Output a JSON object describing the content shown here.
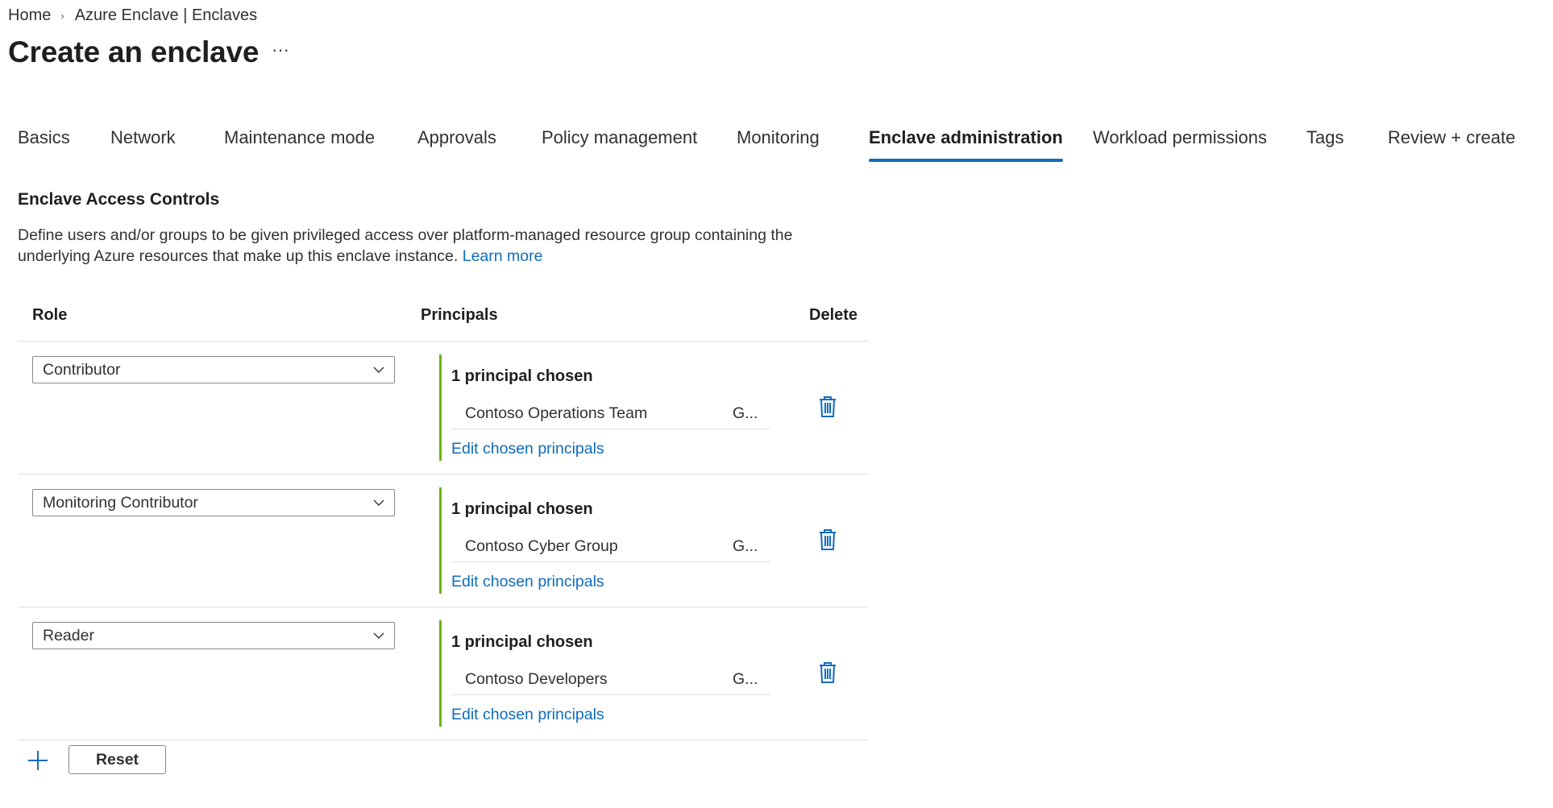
{
  "breadcrumb": {
    "home": "Home",
    "separator": "›",
    "current": "Azure Enclave | Enclaves"
  },
  "page": {
    "title": "Create an enclave",
    "more_label": "···"
  },
  "tabs": [
    {
      "label": "Basics"
    },
    {
      "label": "Network"
    },
    {
      "label": "Maintenance mode"
    },
    {
      "label": "Approvals"
    },
    {
      "label": "Policy management"
    },
    {
      "label": "Monitoring"
    },
    {
      "label": "Enclave administration",
      "active": true
    },
    {
      "label": "Workload permissions"
    },
    {
      "label": "Tags"
    },
    {
      "label": "Review + create"
    }
  ],
  "section": {
    "title": "Enclave Access Controls",
    "description": "Define users and/or groups to be given privileged access over platform-managed resource group containing the underlying Azure resources that make up this enclave instance.",
    "learn_more": "Learn more"
  },
  "table": {
    "headers": {
      "role": "Role",
      "principals": "Principals",
      "delete": "Delete"
    },
    "rows": [
      {
        "role": "Contributor",
        "panel_title": "1 principal chosen",
        "principal": "Contoso Operations Team",
        "principal_type": "G...",
        "edit_label": "Edit chosen principals"
      },
      {
        "role": "Monitoring Contributor",
        "panel_title": "1 principal chosen",
        "principal": "Contoso Cyber Group",
        "principal_type": "G...",
        "edit_label": "Edit chosen principals"
      },
      {
        "role": "Reader",
        "panel_title": "1 principal chosen",
        "principal": "Contoso Developers",
        "principal_type": "G...",
        "edit_label": "Edit chosen principals"
      }
    ]
  },
  "actions": {
    "reset_label": "Reset",
    "add_icon": "plus-icon",
    "delete_icon": "trash-icon"
  },
  "colors": {
    "accent": "#0f6cbd",
    "panel_border": "#6bb700",
    "text": "#323130"
  }
}
